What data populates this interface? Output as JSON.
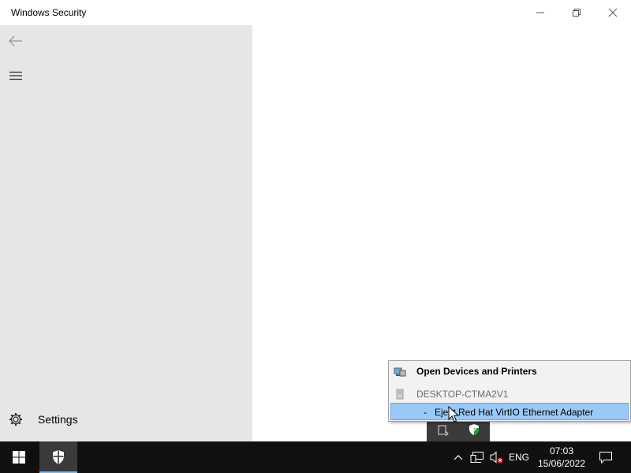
{
  "window": {
    "title": "Windows Security",
    "controls": {
      "minimize_icon": "minimize-icon",
      "maximize_icon": "restore-icon",
      "close_icon": "close-icon"
    }
  },
  "sidebar": {
    "back_icon": "back-arrow-icon",
    "menu_icon": "hamburger-menu-icon",
    "settings_label": "Settings",
    "settings_icon": "gear-icon",
    "background": "#e6e6e6"
  },
  "context_menu": {
    "items": [
      {
        "label": "Open Devices and Printers",
        "icon": "devices-printers-icon",
        "style": "bold"
      },
      {
        "label": "DESKTOP-CTMA2V1",
        "icon": "computer-icon",
        "style": "disabled"
      },
      {
        "prefix": "-",
        "label": "Eject Red Hat VirtIO Ethernet Adapter",
        "style": "highlighted"
      }
    ],
    "highlight_color": "#99c9f7"
  },
  "taskbar": {
    "start_icon": "windows-logo-icon",
    "pinned_app_icon": "windows-security-shield-icon",
    "tray": {
      "chevron_icon": "chevron-up-icon",
      "network_icon": "network-icon",
      "volume_icon": "volume-muted-icon",
      "language": "ENG",
      "time": "07:03",
      "date": "15/06/2022",
      "notification_icon": "action-center-icon"
    },
    "flyout_icons": [
      "safely-remove-hardware-icon",
      "windows-security-tray-icon"
    ],
    "background": "#101010",
    "accent": "#76b9ed"
  }
}
